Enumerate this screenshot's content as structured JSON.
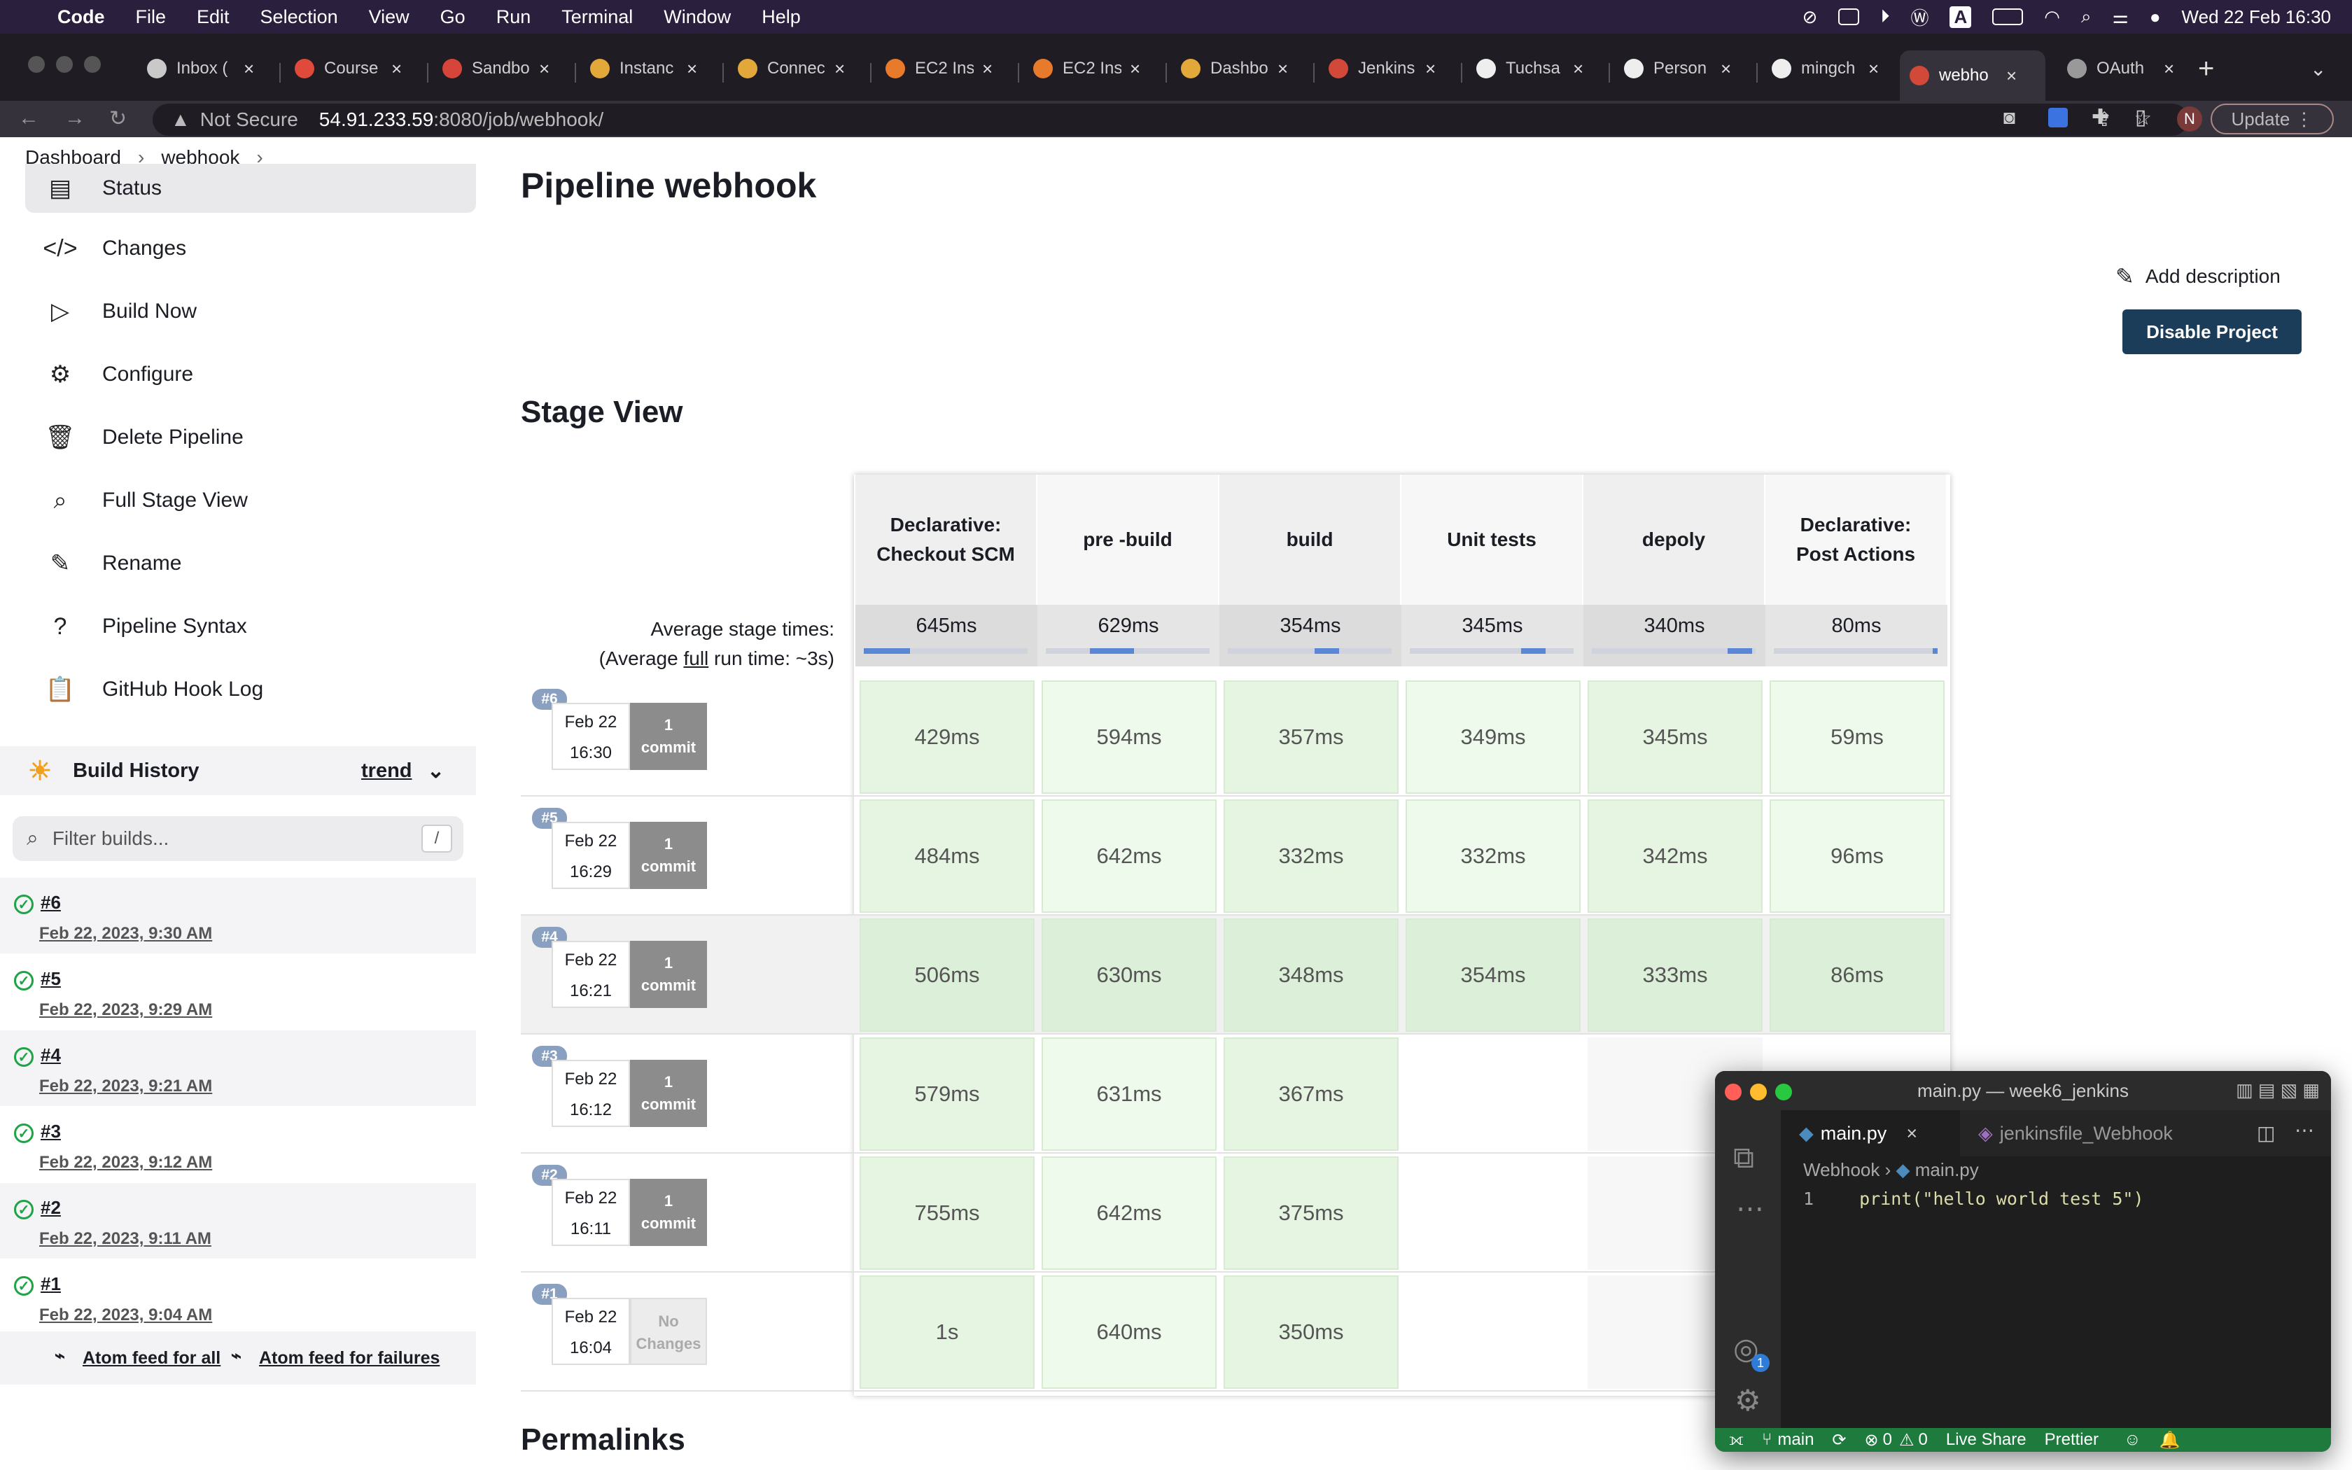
{
  "menubar": {
    "app": "Code",
    "items": [
      "File",
      "Edit",
      "Selection",
      "View",
      "Go",
      "Run",
      "Terminal",
      "Window",
      "Help"
    ],
    "clock": "Wed 22 Feb  16:30",
    "letter_icon": "A"
  },
  "tabs": [
    {
      "label": "Inbox (",
      "icon": "gmail",
      "color": "#c9c9c9"
    },
    {
      "label": "Course",
      "icon": "gmail",
      "color": "#e04a3a"
    },
    {
      "label": "Sandbo",
      "icon": "sandbox",
      "color": "#d6453a"
    },
    {
      "label": "Instanc",
      "icon": "aws-box",
      "color": "#e3a83a"
    },
    {
      "label": "Connec",
      "icon": "aws-box",
      "color": "#e3a83a"
    },
    {
      "label": "EC2 Ins",
      "icon": "ec2",
      "color": "#e77a2b"
    },
    {
      "label": "EC2 Ins",
      "icon": "ec2",
      "color": "#e77a2b"
    },
    {
      "label": "Dashbo",
      "icon": "aws-box",
      "color": "#e3a83a"
    },
    {
      "label": "Jenkins",
      "icon": "jenkins",
      "color": "#d24939"
    },
    {
      "label": "Tuchsa",
      "icon": "github",
      "color": "#eeeeee"
    },
    {
      "label": "Person",
      "icon": "github",
      "color": "#eeeeee"
    },
    {
      "label": "mingch",
      "icon": "github",
      "color": "#eeeeee"
    },
    {
      "label": "webho",
      "icon": "jenkins",
      "color": "#d24939",
      "active": true
    },
    {
      "label": "OAuth",
      "icon": "globe",
      "color": "#999999"
    }
  ],
  "address": {
    "security": "Not Secure",
    "host": "54.91.233.59",
    "rest": ":8080/job/webhook/",
    "update": "Update",
    "profile": "N"
  },
  "breadcrumb": [
    "Dashboard",
    "webhook"
  ],
  "sidebar": {
    "items": [
      {
        "label": "Status",
        "icon": "status-icon",
        "glyph": "▤"
      },
      {
        "label": "Changes",
        "icon": "code-icon",
        "glyph": "</>"
      },
      {
        "label": "Build Now",
        "icon": "play-icon",
        "glyph": "▷"
      },
      {
        "label": "Configure",
        "icon": "gear-icon",
        "glyph": "⚙"
      },
      {
        "label": "Delete Pipeline",
        "icon": "trash-icon",
        "glyph": "🗑"
      },
      {
        "label": "Full Stage View",
        "icon": "search-icon",
        "glyph": "⌕"
      },
      {
        "label": "Rename",
        "icon": "pencil-icon",
        "glyph": "✎"
      },
      {
        "label": "Pipeline Syntax",
        "icon": "help-icon",
        "glyph": "?"
      },
      {
        "label": "GitHub Hook Log",
        "icon": "clipboard-icon",
        "glyph": "📋"
      }
    ],
    "build_history_label": "Build History",
    "trend": "trend",
    "filter_placeholder": "Filter builds...",
    "filter_shortcut": "/",
    "builds": [
      {
        "num": "#6",
        "date": "Feb 22, 2023, 9:30 AM"
      },
      {
        "num": "#5",
        "date": "Feb 22, 2023, 9:29 AM"
      },
      {
        "num": "#4",
        "date": "Feb 22, 2023, 9:21 AM"
      },
      {
        "num": "#3",
        "date": "Feb 22, 2023, 9:12 AM"
      },
      {
        "num": "#2",
        "date": "Feb 22, 2023, 9:11 AM"
      },
      {
        "num": "#1",
        "date": "Feb 22, 2023, 9:04 AM"
      }
    ],
    "atom_all": "Atom feed for all",
    "atom_fail": "Atom feed for failures"
  },
  "main": {
    "title": "Pipeline webhook",
    "add_description": "Add description",
    "disable_button": "Disable Project",
    "stage_view_title": "Stage View",
    "avg_label_1": "Average stage times:",
    "avg_label_2a": "(Average ",
    "avg_label_2b": "full",
    "avg_label_2c": " run time: ~3s)",
    "permalinks": "Permalinks"
  },
  "stages": [
    {
      "name": "Declarative: Checkout SCM",
      "avg": "645ms",
      "bar": [
        0.0,
        0.28
      ]
    },
    {
      "name": "pre -build",
      "avg": "629ms",
      "bar": [
        0.27,
        0.54
      ]
    },
    {
      "name": "build",
      "avg": "354ms",
      "bar": [
        0.53,
        0.68
      ]
    },
    {
      "name": "Unit tests",
      "avg": "345ms",
      "bar": [
        0.68,
        0.83
      ]
    },
    {
      "name": "depoly",
      "avg": "340ms",
      "bar": [
        0.83,
        0.98
      ]
    },
    {
      "name": "Declarative: Post Actions",
      "avg": "80ms",
      "bar": [
        0.97,
        1.0
      ]
    }
  ],
  "runs": [
    {
      "badge": "#6",
      "date": "Feb 22",
      "time": "16:30",
      "changes": [
        "1",
        "commit"
      ],
      "times": [
        "429ms",
        "594ms",
        "357ms",
        "349ms",
        "345ms",
        "59ms"
      ]
    },
    {
      "badge": "#5",
      "date": "Feb 22",
      "time": "16:29",
      "changes": [
        "1",
        "commit"
      ],
      "times": [
        "484ms",
        "642ms",
        "332ms",
        "332ms",
        "342ms",
        "96ms"
      ]
    },
    {
      "badge": "#4",
      "date": "Feb 22",
      "time": "16:21",
      "changes": [
        "1",
        "commit"
      ],
      "times": [
        "506ms",
        "630ms",
        "348ms",
        "354ms",
        "333ms",
        "86ms"
      ]
    },
    {
      "badge": "#3",
      "date": "Feb 22",
      "time": "16:12",
      "changes": [
        "1",
        "commit"
      ],
      "times": [
        "579ms",
        "631ms",
        "367ms",
        "",
        "",
        ""
      ]
    },
    {
      "badge": "#2",
      "date": "Feb 22",
      "time": "16:11",
      "changes": [
        "1",
        "commit"
      ],
      "times": [
        "755ms",
        "642ms",
        "375ms",
        "",
        "",
        ""
      ]
    },
    {
      "badge": "#1",
      "date": "Feb 22",
      "time": "16:04",
      "changes": [
        "No",
        "Changes"
      ],
      "no_changes": true,
      "times": [
        "1s",
        "640ms",
        "350ms",
        "",
        "",
        ""
      ]
    }
  ],
  "vscode": {
    "title": "main.py — week6_jenkins",
    "tab1": "main.py",
    "tab2": "jenkinsfile_Webhook",
    "crumb_folder": "Webhook",
    "crumb_file": "main.py",
    "line_no": "1",
    "code": "print(\"hello world test 5\")",
    "accounts_badge": "1",
    "branch": "main",
    "errors": "0",
    "warnings": "0",
    "live_share": "Live Share",
    "prettier": "Prettier"
  }
}
